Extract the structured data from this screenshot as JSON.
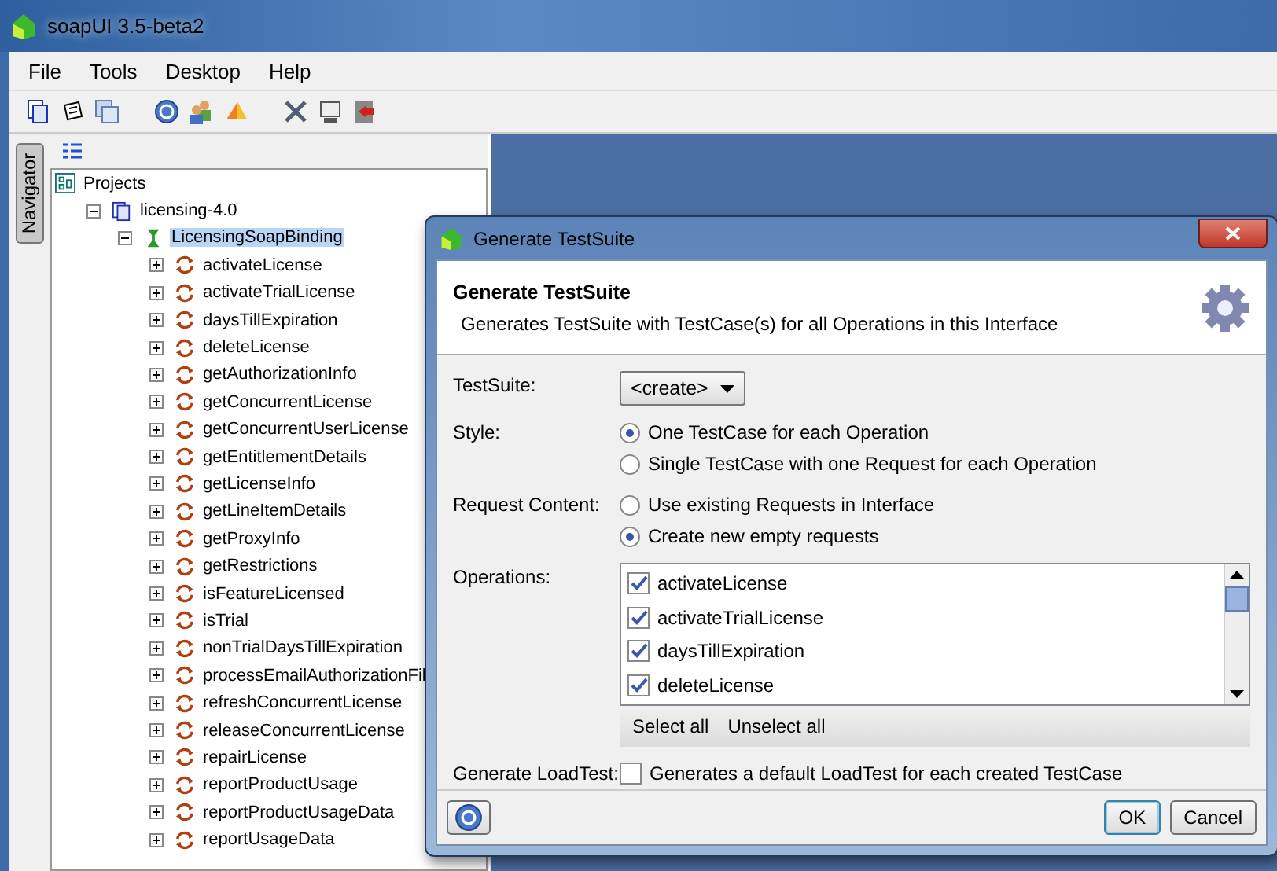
{
  "window": {
    "title": "soapUI 3.5-beta2"
  },
  "menu": [
    "File",
    "Tools",
    "Desktop",
    "Help"
  ],
  "navigator": {
    "tab": "Navigator"
  },
  "tree": [
    {
      "label": "Projects",
      "kind": "root",
      "children": [
        {
          "label": "licensing-4.0",
          "kind": "project",
          "expanded": true,
          "selected": false,
          "children": [
            {
              "label": "LicensingSoapBinding",
              "kind": "interface",
              "expanded": true,
              "selected": true,
              "children": [
                {
                  "label": "activateLicense",
                  "kind": "operation",
                  "expanded": false,
                  "selected": false
                },
                {
                  "label": "activateTrialLicense",
                  "kind": "operation",
                  "expanded": false,
                  "selected": false
                },
                {
                  "label": "daysTillExpiration",
                  "kind": "operation",
                  "expanded": false,
                  "selected": false
                },
                {
                  "label": "deleteLicense",
                  "kind": "operation",
                  "expanded": false,
                  "selected": false
                },
                {
                  "label": "getAuthorizationInfo",
                  "kind": "operation",
                  "expanded": false,
                  "selected": false
                },
                {
                  "label": "getConcurrentLicense",
                  "kind": "operation",
                  "expanded": false,
                  "selected": false
                },
                {
                  "label": "getConcurrentUserLicense",
                  "kind": "operation",
                  "expanded": false,
                  "selected": false
                },
                {
                  "label": "getEntitlementDetails",
                  "kind": "operation",
                  "expanded": false,
                  "selected": false
                },
                {
                  "label": "getLicenseInfo",
                  "kind": "operation",
                  "expanded": false,
                  "selected": false
                },
                {
                  "label": "getLineItemDetails",
                  "kind": "operation",
                  "expanded": false,
                  "selected": false
                },
                {
                  "label": "getProxyInfo",
                  "kind": "operation",
                  "expanded": false,
                  "selected": false
                },
                {
                  "label": "getRestrictions",
                  "kind": "operation",
                  "expanded": false,
                  "selected": false
                },
                {
                  "label": "isFeatureLicensed",
                  "kind": "operation",
                  "expanded": false,
                  "selected": false
                },
                {
                  "label": "isTrial",
                  "kind": "operation",
                  "expanded": false,
                  "selected": false
                },
                {
                  "label": "nonTrialDaysTillExpiration",
                  "kind": "operation",
                  "expanded": false,
                  "selected": false
                },
                {
                  "label": "processEmailAuthorizationFil",
                  "kind": "operation",
                  "expanded": false,
                  "selected": false
                },
                {
                  "label": "refreshConcurrentLicense",
                  "kind": "operation",
                  "expanded": false,
                  "selected": false
                },
                {
                  "label": "releaseConcurrentLicense",
                  "kind": "operation",
                  "expanded": false,
                  "selected": false
                },
                {
                  "label": "repairLicense",
                  "kind": "operation",
                  "expanded": false,
                  "selected": false
                },
                {
                  "label": "reportProductUsage",
                  "kind": "operation",
                  "expanded": false,
                  "selected": false
                },
                {
                  "label": "reportProductUsageData",
                  "kind": "operation",
                  "expanded": false,
                  "selected": false
                },
                {
                  "label": "reportUsageData",
                  "kind": "operation",
                  "expanded": false,
                  "selected": false
                }
              ]
            }
          ]
        }
      ]
    }
  ],
  "dialog": {
    "title": "Generate TestSuite",
    "header": "Generate TestSuite",
    "description": "Generates TestSuite with TestCase(s) for all Operations in this Interface",
    "testsuite": {
      "label": "TestSuite:",
      "value": "<create>"
    },
    "style": {
      "label": "Style:",
      "options": [
        {
          "label": "One TestCase for each Operation",
          "selected": true
        },
        {
          "label": "Single TestCase with one Request for each Operation",
          "selected": false
        }
      ]
    },
    "request_content": {
      "label": "Request Content:",
      "options": [
        {
          "label": "Use existing Requests in Interface",
          "selected": false
        },
        {
          "label": "Create new empty requests",
          "selected": true
        }
      ]
    },
    "operations": {
      "label": "Operations:",
      "items": [
        {
          "label": "activateLicense",
          "checked": true
        },
        {
          "label": "activateTrialLicense",
          "checked": true
        },
        {
          "label": "daysTillExpiration",
          "checked": true
        },
        {
          "label": "deleteLicense",
          "checked": true
        }
      ],
      "buttons": [
        "Select all",
        "Unselect all"
      ]
    },
    "loadtest": {
      "label": "Generate LoadTest:",
      "text": "Generates a default LoadTest for each created TestCase",
      "checked": false
    },
    "buttons": [
      "OK",
      "Cancel"
    ]
  }
}
